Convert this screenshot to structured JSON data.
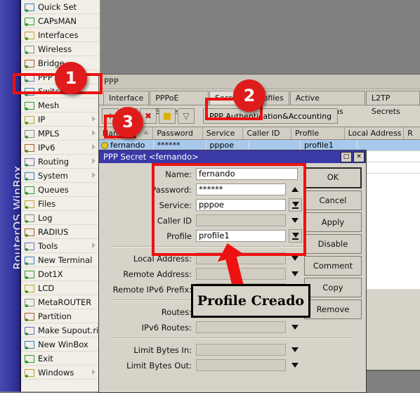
{
  "brand": {
    "label": "RouterOS WinBox",
    "strip_color": "#3b3ba8"
  },
  "sidebar": {
    "items": [
      {
        "label": "Quick Set",
        "icon": "wand-icon",
        "submenu": false
      },
      {
        "label": "CAPsMAN",
        "icon": "capsman-icon",
        "submenu": false
      },
      {
        "label": "Interfaces",
        "icon": "interfaces-icon",
        "submenu": false
      },
      {
        "label": "Wireless",
        "icon": "wireless-icon",
        "submenu": false
      },
      {
        "label": "Bridge",
        "icon": "bridge-icon",
        "submenu": false
      },
      {
        "label": "PPP",
        "icon": "ppp-icon",
        "submenu": false
      },
      {
        "label": "Switch",
        "icon": "switch-icon",
        "submenu": false
      },
      {
        "label": "Mesh",
        "icon": "mesh-icon",
        "submenu": false
      },
      {
        "label": "IP",
        "icon": "ip-icon",
        "submenu": true
      },
      {
        "label": "MPLS",
        "icon": "mpls-icon",
        "submenu": true
      },
      {
        "label": "IPv6",
        "icon": "ipv6-icon",
        "submenu": true
      },
      {
        "label": "Routing",
        "icon": "routing-icon",
        "submenu": true
      },
      {
        "label": "System",
        "icon": "system-icon",
        "submenu": true
      },
      {
        "label": "Queues",
        "icon": "queues-icon",
        "submenu": false
      },
      {
        "label": "Files",
        "icon": "folder-icon",
        "submenu": false
      },
      {
        "label": "Log",
        "icon": "log-icon",
        "submenu": false
      },
      {
        "label": "RADIUS",
        "icon": "radius-icon",
        "submenu": false
      },
      {
        "label": "Tools",
        "icon": "tools-icon",
        "submenu": true
      },
      {
        "label": "New Terminal",
        "icon": "terminal-icon",
        "submenu": false
      },
      {
        "label": "Dot1X",
        "icon": "dot1x-icon",
        "submenu": false
      },
      {
        "label": "LCD",
        "icon": "lcd-icon",
        "submenu": false
      },
      {
        "label": "MetaROUTER",
        "icon": "metarouter-icon",
        "submenu": false
      },
      {
        "label": "Partition",
        "icon": "partition-icon",
        "submenu": false
      },
      {
        "label": "Make Supout.rif",
        "icon": "supout-icon",
        "submenu": false
      },
      {
        "label": "New WinBox",
        "icon": "winbox-icon",
        "submenu": false
      },
      {
        "label": "Exit",
        "icon": "exit-icon",
        "submenu": false
      },
      {
        "label": "Windows",
        "icon": "windows-icon",
        "submenu": true
      }
    ]
  },
  "ppp_window": {
    "title": "PPP",
    "tabs": [
      {
        "label": "Interface",
        "active": false
      },
      {
        "label": "PPPoE Servers",
        "active": false
      },
      {
        "label": "Secrets",
        "active": true
      },
      {
        "label": "Profiles",
        "active": false
      },
      {
        "label": "Active Connections",
        "active": false
      },
      {
        "label": "L2TP Secrets",
        "active": false
      }
    ],
    "toolbar": {
      "add_label": "+",
      "enable_label": "✔",
      "disable_label": "✖",
      "comment_label": "■",
      "filter_label": "▽",
      "auth_button": "PPP Authentication&Accounting"
    },
    "table": {
      "columns": [
        "Name",
        "Password",
        "Service",
        "Caller ID",
        "Profile",
        "Local Address",
        "R"
      ],
      "rows": [
        {
          "name": "fernando",
          "password": "******",
          "service": "pppoe",
          "caller_id": "",
          "profile": "profile1",
          "local_address": "",
          "selected": true
        },
        {
          "name": "",
          "password": "",
          "service": "",
          "caller_id": "",
          "profile": "",
          "local_address": "",
          "selected": false
        },
        {
          "name": "",
          "password": "",
          "service": "",
          "caller_id": "",
          "profile": "",
          "local_address": "",
          "selected": false
        }
      ]
    }
  },
  "dialog": {
    "title": "PPP Secret <fernando>",
    "restore_glyph": "□",
    "close_glyph": "✕",
    "fields": [
      {
        "label": "Name:",
        "value": "fernando",
        "control": "none",
        "disabled": false
      },
      {
        "label": "Password:",
        "value": "******",
        "control": "up",
        "disabled": false
      },
      {
        "label": "Service:",
        "value": "pppoe",
        "control": "boxed-down",
        "disabled": false
      },
      {
        "label": "Caller ID",
        "value": "",
        "control": "down",
        "disabled": true
      },
      {
        "label": "Profile",
        "value": "profile1",
        "control": "boxed-down",
        "disabled": false
      },
      {
        "label": "Local Address:",
        "value": "",
        "control": "down",
        "disabled": true
      },
      {
        "label": "Remote Address:",
        "value": "",
        "control": "down",
        "disabled": true
      },
      {
        "label": "Remote IPv6 Prefix:",
        "value": "",
        "control": "down",
        "disabled": true
      },
      {
        "label": "Routes:",
        "value": "",
        "control": "down",
        "disabled": true
      },
      {
        "label": "IPv6 Routes:",
        "value": "",
        "control": "down",
        "disabled": true
      },
      {
        "label": "Limit Bytes In:",
        "value": "",
        "control": "down",
        "disabled": true
      },
      {
        "label": "Limit Bytes Out:",
        "value": "",
        "control": "down",
        "disabled": true
      }
    ],
    "buttons": [
      {
        "label": "OK",
        "primary": true
      },
      {
        "label": "Cancel",
        "primary": false
      },
      {
        "label": "Apply",
        "primary": false
      },
      {
        "label": "Disable",
        "primary": false
      },
      {
        "label": "Comment",
        "primary": false
      },
      {
        "label": "Copy",
        "primary": false
      },
      {
        "label": "Remove",
        "primary": false
      }
    ]
  },
  "annotations": {
    "badge_1": "1",
    "badge_2": "2",
    "badge_3": "3",
    "callout_text": "Profile Creado",
    "highlight_color": "#ee1111",
    "badge_color": "#e01b1b"
  }
}
